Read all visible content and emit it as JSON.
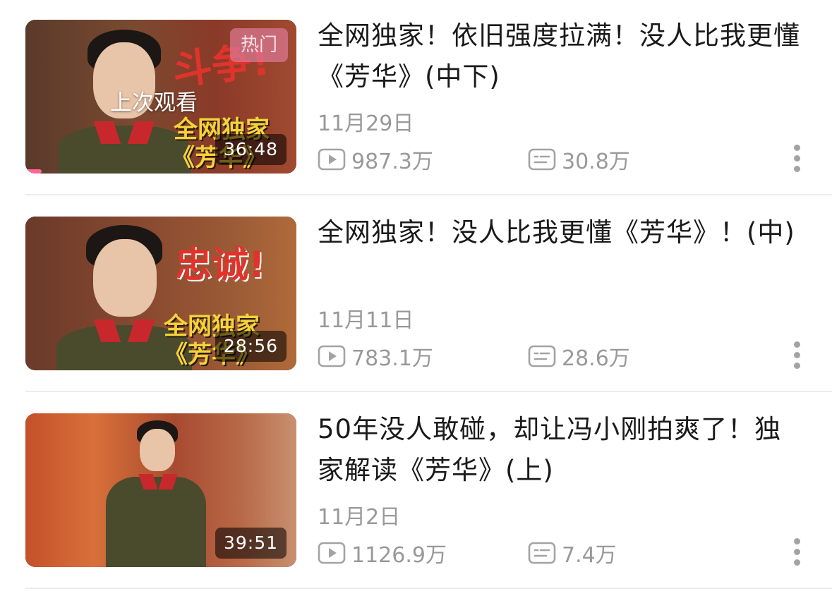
{
  "videos": [
    {
      "title": "全网独家！依旧强度拉满！没人比我更懂《芳华》(中下)",
      "date": "11月29日",
      "views": "987.3万",
      "comments": "30.8万",
      "duration": "36:48",
      "badge": "热门",
      "last_watched_label": "上次观看",
      "thumb_big_text": "斗争!",
      "thumb_text_line1": "全网独家",
      "thumb_text_line2": "《芳华》",
      "watch_progress": 0.06
    },
    {
      "title": "全网独家！没人比我更懂《芳华》！(中)",
      "date": "11月11日",
      "views": "783.1万",
      "comments": "28.6万",
      "duration": "28:56",
      "thumb_big_text": "忠诚!",
      "thumb_text_line1": "全网独家",
      "thumb_text_line2": "《芳华》"
    },
    {
      "title": "50年没人敢碰，却让冯小刚拍爽了！独家解读《芳华》(上)",
      "date": "11月2日",
      "views": "1126.9万",
      "comments": "7.4万",
      "duration": "39:51"
    }
  ],
  "icons": {
    "views": "play-count-icon",
    "comments": "danmaku-icon",
    "more": "more-vertical-icon"
  },
  "colors": {
    "accent": "#ff6699",
    "meta_text": "#999999",
    "title_text": "#1a1a1a"
  }
}
